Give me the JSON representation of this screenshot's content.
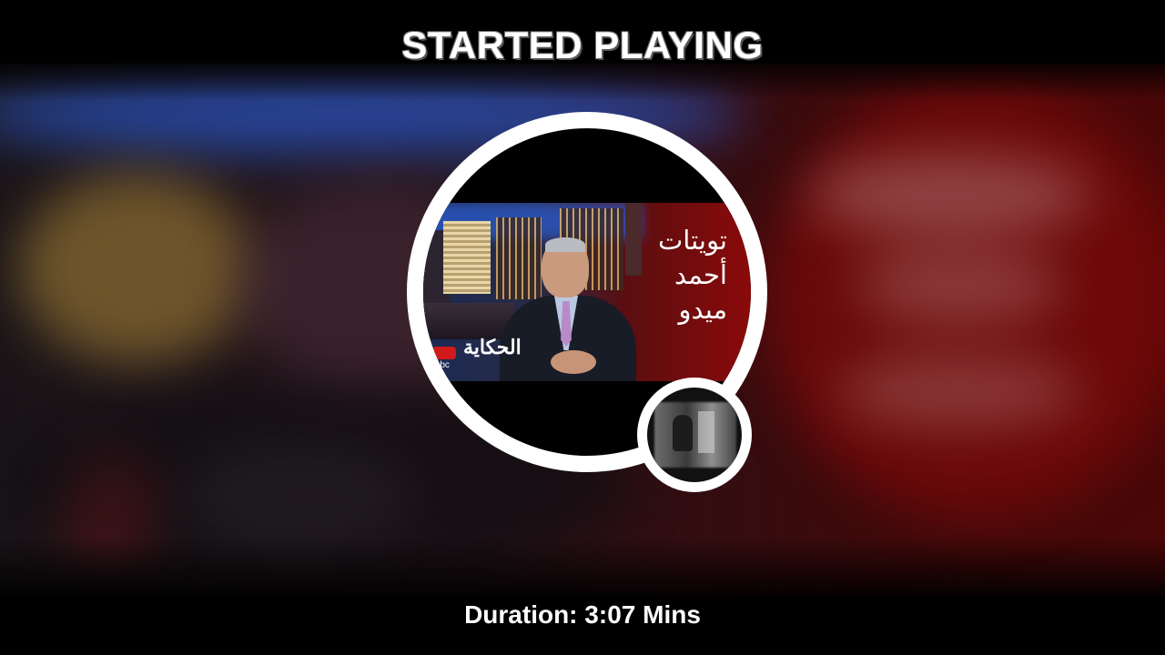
{
  "header": {
    "title": "STARTED PLAYING"
  },
  "now_playing": {
    "thumbnail_overlay_lines": [
      "تويتات",
      "أحمد",
      "ميدو"
    ],
    "channel_logo": "mbc",
    "show_logo_text": "الحكاية"
  },
  "footer": {
    "duration_label": "Duration:",
    "duration_value": "3:07 Mins"
  },
  "colors": {
    "background": "#000000",
    "ring": "#ffffff",
    "accent_red": "#8a0a0a",
    "text": "#ffffff"
  },
  "icons": {
    "main_thumbnail": "video-thumbnail",
    "secondary_thumbnail": "avatar-thumbnail"
  }
}
